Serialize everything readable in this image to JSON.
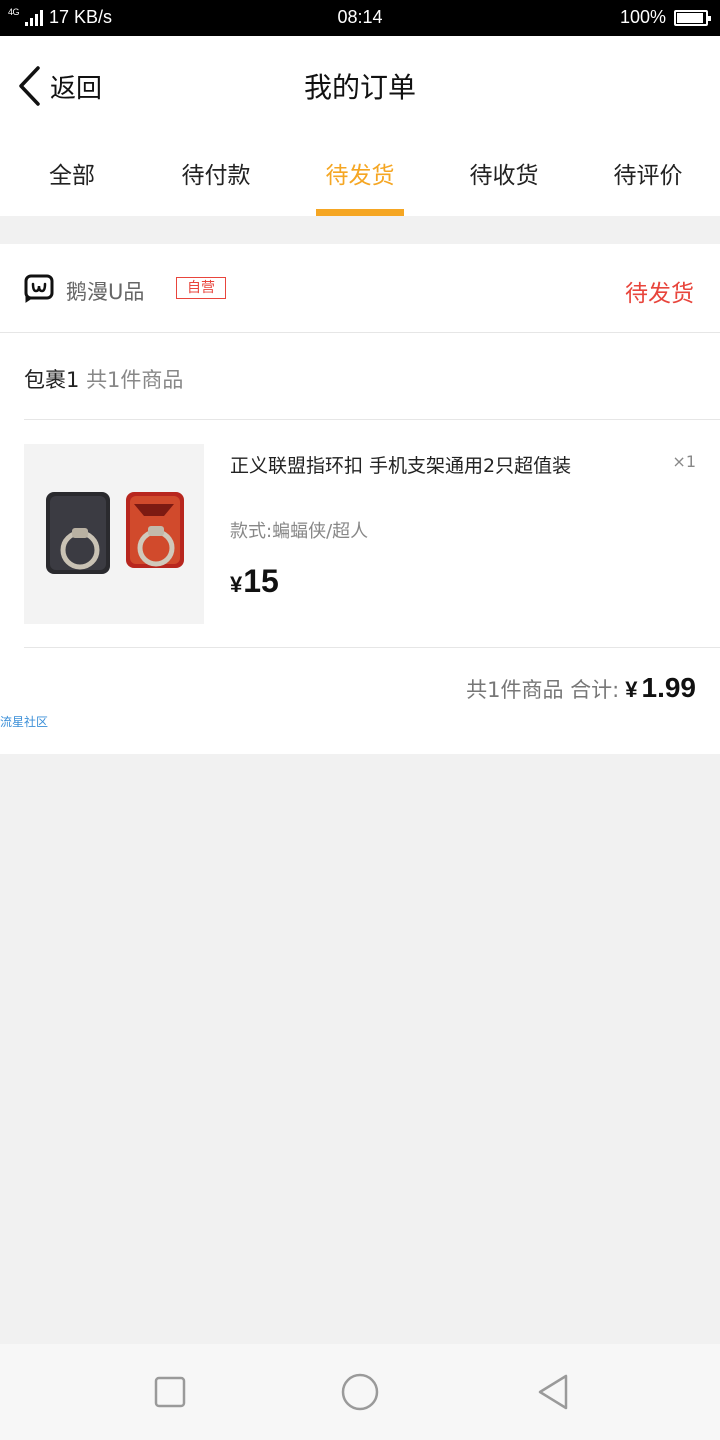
{
  "status_bar": {
    "network": "4G",
    "speed": "17 KB/s",
    "time": "08:14",
    "battery": "100%",
    "battery_level": 1.0
  },
  "header": {
    "back_label": "返回",
    "title": "我的订单"
  },
  "tabs": [
    {
      "label": "全部",
      "active": false
    },
    {
      "label": "待付款",
      "active": false
    },
    {
      "label": "待发货",
      "active": true
    },
    {
      "label": "待收货",
      "active": false
    },
    {
      "label": "待评价",
      "active": false
    }
  ],
  "order": {
    "shop_name": "鹅漫U品",
    "self_badge": "自营",
    "status": "待发货",
    "package_label": "包裹1",
    "package_count": "共1件商品",
    "item": {
      "name": "正义联盟指环扣 手机支架通用2只超值装",
      "spec": "款式:蝙蝠侠/超人",
      "quantity": "×1",
      "currency": "¥",
      "price": "15"
    },
    "summary": {
      "count_text": "共1件商品 合计:",
      "currency": "¥",
      "total": "1.99"
    }
  },
  "watermark": "流星社区",
  "colors": {
    "accent": "#f5a623",
    "status_red": "#e8453c",
    "page_bg": "#f1f1f1"
  },
  "nav_icons": [
    "recent-apps-icon",
    "home-icon",
    "back-icon"
  ]
}
